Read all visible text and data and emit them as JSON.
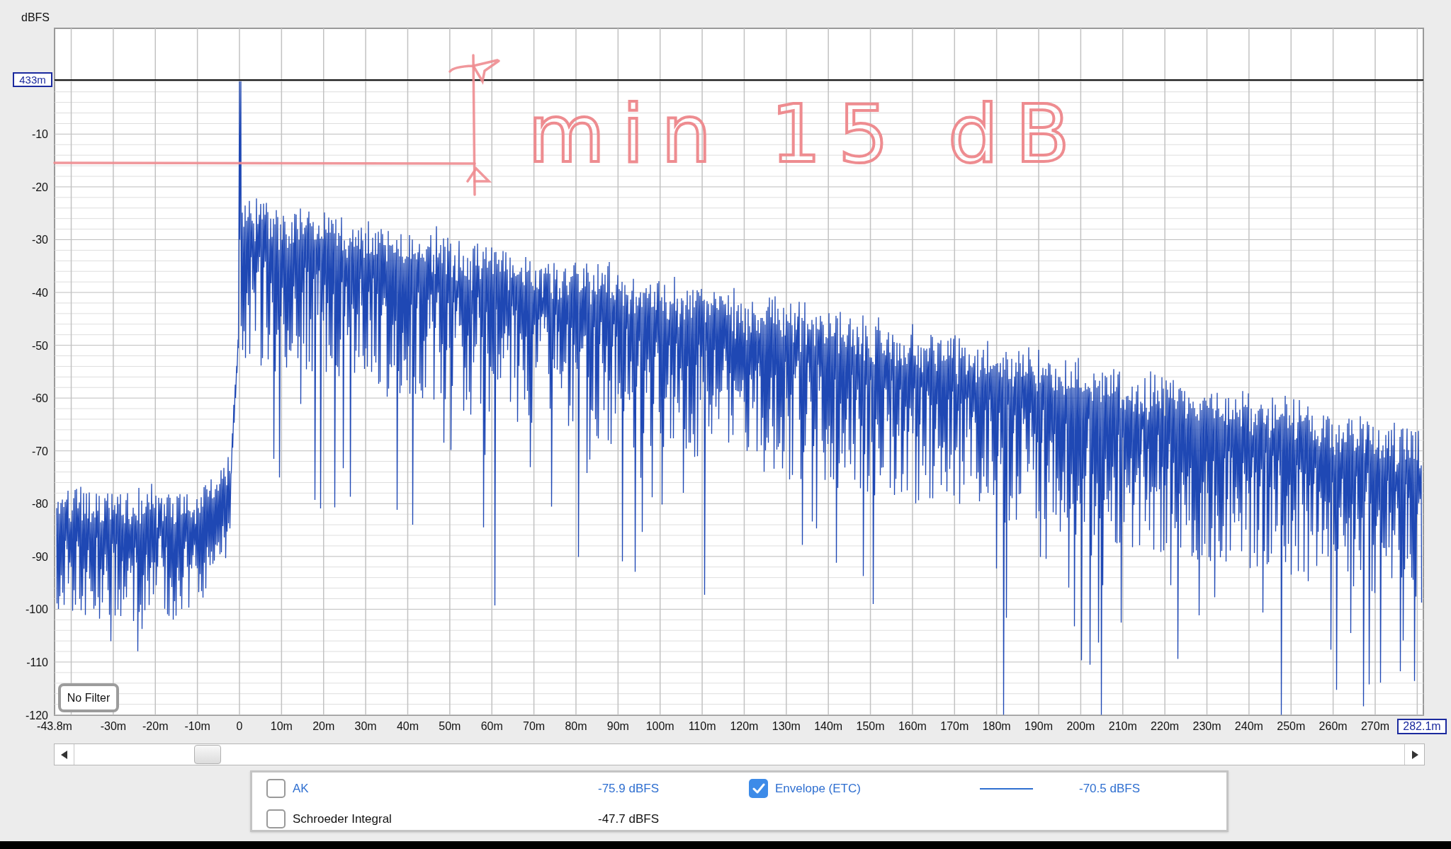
{
  "plot": {
    "y_axis_title": "dBFS",
    "y_ticks": [
      "-10",
      "-20",
      "-30",
      "-40",
      "-50",
      "-60",
      "-70",
      "-80",
      "-90",
      "-100",
      "-110",
      "-120"
    ],
    "x_ticks": [
      "-43.8m",
      "-30m",
      "-20m",
      "-10m",
      "0",
      "10m",
      "20m",
      "30m",
      "40m",
      "50m",
      "60m",
      "70m",
      "80m",
      "90m",
      "100m",
      "110m",
      "120m",
      "130m",
      "140m",
      "150m",
      "160m",
      "170m",
      "180m",
      "190m",
      "200m",
      "210m",
      "220m",
      "230m",
      "240m",
      "250m",
      "260m",
      "270m"
    ],
    "cursor_level": "433m",
    "x_end": "282.1m",
    "filter_button": "No Filter",
    "note": "min 15 dB"
  },
  "legend": [
    {
      "kind": "trace",
      "label": "AK",
      "value": "-75.9 dBFS",
      "checked": false,
      "color": "#2f6fd0"
    },
    {
      "kind": "trace-with-line",
      "label": "Envelope (ETC)",
      "value": "-70.5 dBFS",
      "checked": true,
      "color": "#2f6fd0"
    },
    {
      "kind": "trace",
      "label": "Schroeder Integral",
      "value": "-47.7 dBFS",
      "checked": false,
      "color": "#111111"
    }
  ]
}
